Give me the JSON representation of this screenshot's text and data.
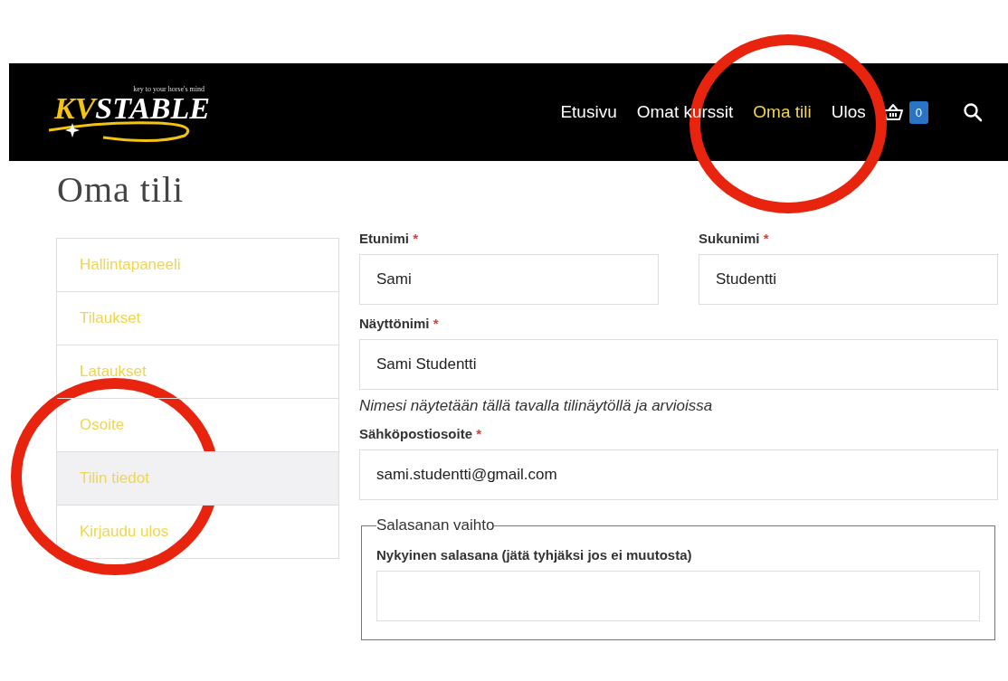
{
  "header": {
    "logo": {
      "mark": "KV",
      "name": "STABLE",
      "tagline": "key to your horse's mind"
    },
    "nav": [
      {
        "label": "Etusivu",
        "selected": false
      },
      {
        "label": "Omat kurssit",
        "selected": false
      },
      {
        "label": "Oma tili",
        "selected": true
      },
      {
        "label": "Ulos",
        "selected": false
      }
    ],
    "cart_count": "0"
  },
  "page_title": "Oma tili",
  "sidebar": {
    "items": [
      {
        "label": "Hallintapaneeli",
        "selected": false
      },
      {
        "label": "Tilaukset",
        "selected": false
      },
      {
        "label": "Lataukset",
        "selected": false
      },
      {
        "label": "Osoite",
        "selected": false
      },
      {
        "label": "Tilin tiedot",
        "selected": true
      },
      {
        "label": "Kirjaudu ulos",
        "selected": false
      }
    ]
  },
  "form": {
    "rows": [
      [
        {
          "label": "Etunimi",
          "required_mark": "*",
          "value": "Sami"
        },
        {
          "label": "Sukunimi",
          "required_mark": "*",
          "value": "Studentti"
        }
      ],
      [
        {
          "label": "Näyttönimi",
          "required_mark": "*",
          "value": "Sami Studentti",
          "hint": "Nimesi näytetään tällä tavalla tilinäytöllä ja arvioissa"
        }
      ],
      [
        {
          "label": "Sähköpostiosoite",
          "required_mark": "*",
          "value": "sami.studentti@gmail.com"
        }
      ]
    ],
    "password": {
      "legend": "Salasanan vaihto",
      "label": "Nykyinen salasana (jätä tyhjäksi jos ei muutosta)"
    }
  }
}
